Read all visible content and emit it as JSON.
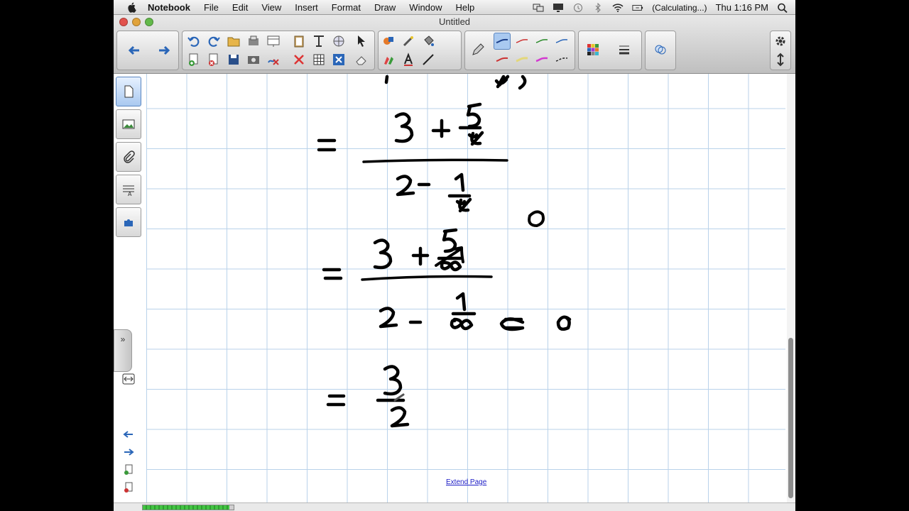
{
  "menubar": {
    "items": [
      "Notebook",
      "File",
      "Edit",
      "View",
      "Insert",
      "Format",
      "Draw",
      "Window",
      "Help"
    ],
    "battery_status": "(Calculating...)",
    "clock": "Thu 1:16 PM"
  },
  "window": {
    "title": "Untitled"
  },
  "canvas": {
    "extend_link": "Extend Page",
    "grid_color": "#b9d2ea",
    "ink_color": "#000000",
    "equations": [
      "= (3 + 5/x) / (2 - 1/x)",
      "= (3 + 5/∞) / (2 - 1/∞)  ← 0",
      "= 3/2"
    ]
  },
  "status": {
    "progress": 0.95
  },
  "colors": {
    "accent_selected": "#5a86c0",
    "scrollbar": "#8d8d8d"
  }
}
